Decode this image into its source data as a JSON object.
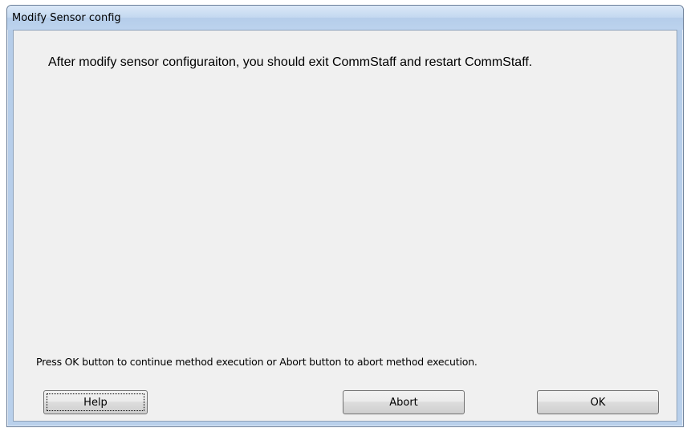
{
  "window": {
    "title": "Modify Sensor config"
  },
  "dialog": {
    "message": "After modify sensor configuraiton, you should exit CommStaff and restart CommStaff.",
    "instruction": "Press OK button to continue method execution or Abort button to abort method execution."
  },
  "buttons": {
    "help_label": "Help",
    "abort_label": "Abort",
    "ok_label": "OK"
  },
  "colors": {
    "titlebar": "#c3d8f0",
    "client_background": "#f0f0f0",
    "button_border": "#707070"
  }
}
